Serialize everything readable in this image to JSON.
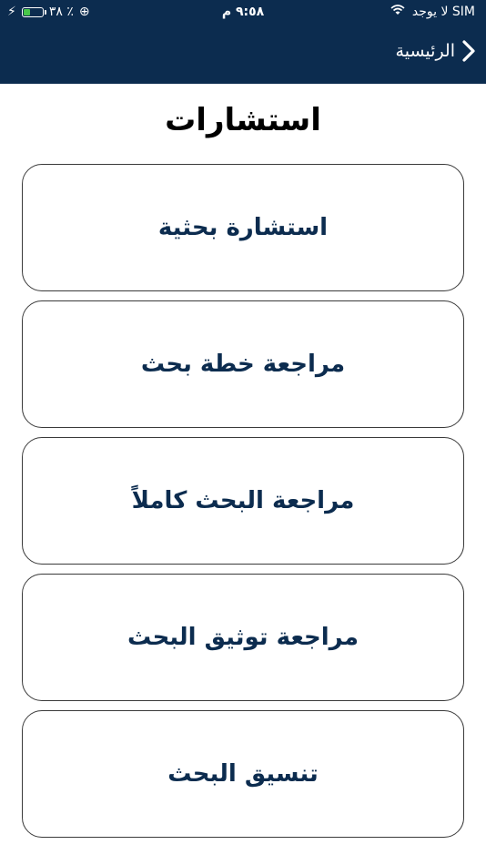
{
  "status_bar": {
    "carrier": "لا يوجد SIM",
    "time": "٩:٥٨ م",
    "battery_percent": "٣٨ ٪",
    "battery_level": 0.38,
    "colors": {
      "background": "#0c2c4f",
      "battery_fill": "#48c74a"
    }
  },
  "nav": {
    "back_label": "الرئيسية",
    "back_icon": "chevron-right-icon"
  },
  "page": {
    "title": "استشارات"
  },
  "menu": {
    "items": [
      {
        "label": "استشارة بحثية"
      },
      {
        "label": "مراجعة خطة بحث"
      },
      {
        "label": "مراجعة البحث كاملاً"
      },
      {
        "label": "مراجعة توثيق البحث"
      },
      {
        "label": "تنسيق البحث"
      }
    ],
    "colors": {
      "text": "#0c2c4f",
      "border": "#3a3a3a"
    }
  }
}
